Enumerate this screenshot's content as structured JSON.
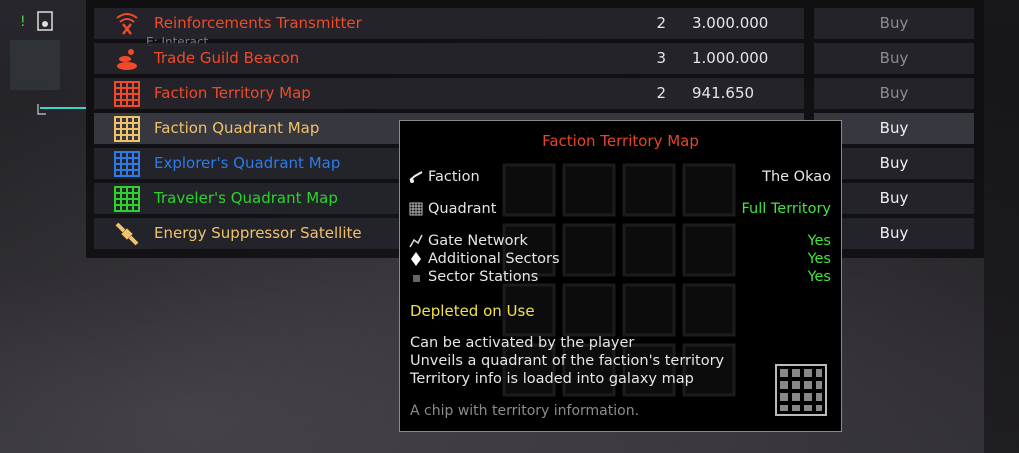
{
  "hud": {
    "exclaim": "!"
  },
  "interact_hint": "E: Interact",
  "items": [
    {
      "name": "Reinforcements Transmitter",
      "color": "#f04a2a",
      "icon": "transmitter-icon",
      "qty": "2",
      "price": "3.000.000",
      "buy": "Buy",
      "buy_enabled": false
    },
    {
      "name": "Trade Guild Beacon",
      "color": "#f04a2a",
      "icon": "beacon-icon",
      "qty": "3",
      "price": "1.000.000",
      "buy": "Buy",
      "buy_enabled": false
    },
    {
      "name": "Faction Territory Map",
      "color": "#f04a2a",
      "icon": "grid-map-icon",
      "qty": "2",
      "price": "941.650",
      "buy": "Buy",
      "buy_enabled": false
    },
    {
      "name": "Faction Quadrant Map",
      "color": "#f0c26a",
      "icon": "grid-map-icon",
      "qty": "",
      "price": "",
      "buy": "Buy",
      "buy_enabled": true
    },
    {
      "name": "Explorer's Quadrant Map",
      "color": "#2e7be8",
      "icon": "grid-map-icon",
      "qty": "",
      "price": "",
      "buy": "Buy",
      "buy_enabled": true
    },
    {
      "name": "Traveler's Quadrant Map",
      "color": "#2ed12e",
      "icon": "grid-map-icon",
      "qty": "",
      "price": "",
      "buy": "Buy",
      "buy_enabled": true
    },
    {
      "name": "Energy Suppressor Satellite",
      "color": "#f0c26a",
      "icon": "satellite-icon",
      "qty": "",
      "price": "",
      "buy": "Buy",
      "buy_enabled": true
    }
  ],
  "tooltip": {
    "title": "Faction Territory Map",
    "faction_label": "Faction",
    "faction_value": "The Okao",
    "quadrant_label": "Quadrant",
    "quadrant_value": "Full Territory",
    "gate_label": "Gate Network",
    "gate_value": "Yes",
    "sectors_label": "Additional Sectors",
    "sectors_value": "Yes",
    "stations_label": "Sector Stations",
    "stations_value": "Yes",
    "depleted": "Depleted on Use",
    "desc1": "Can be activated by the player",
    "desc2": "Unveils a quadrant of the faction's territory",
    "desc3": "Territory info is loaded into galaxy map",
    "footer": "A chip with territory information."
  }
}
